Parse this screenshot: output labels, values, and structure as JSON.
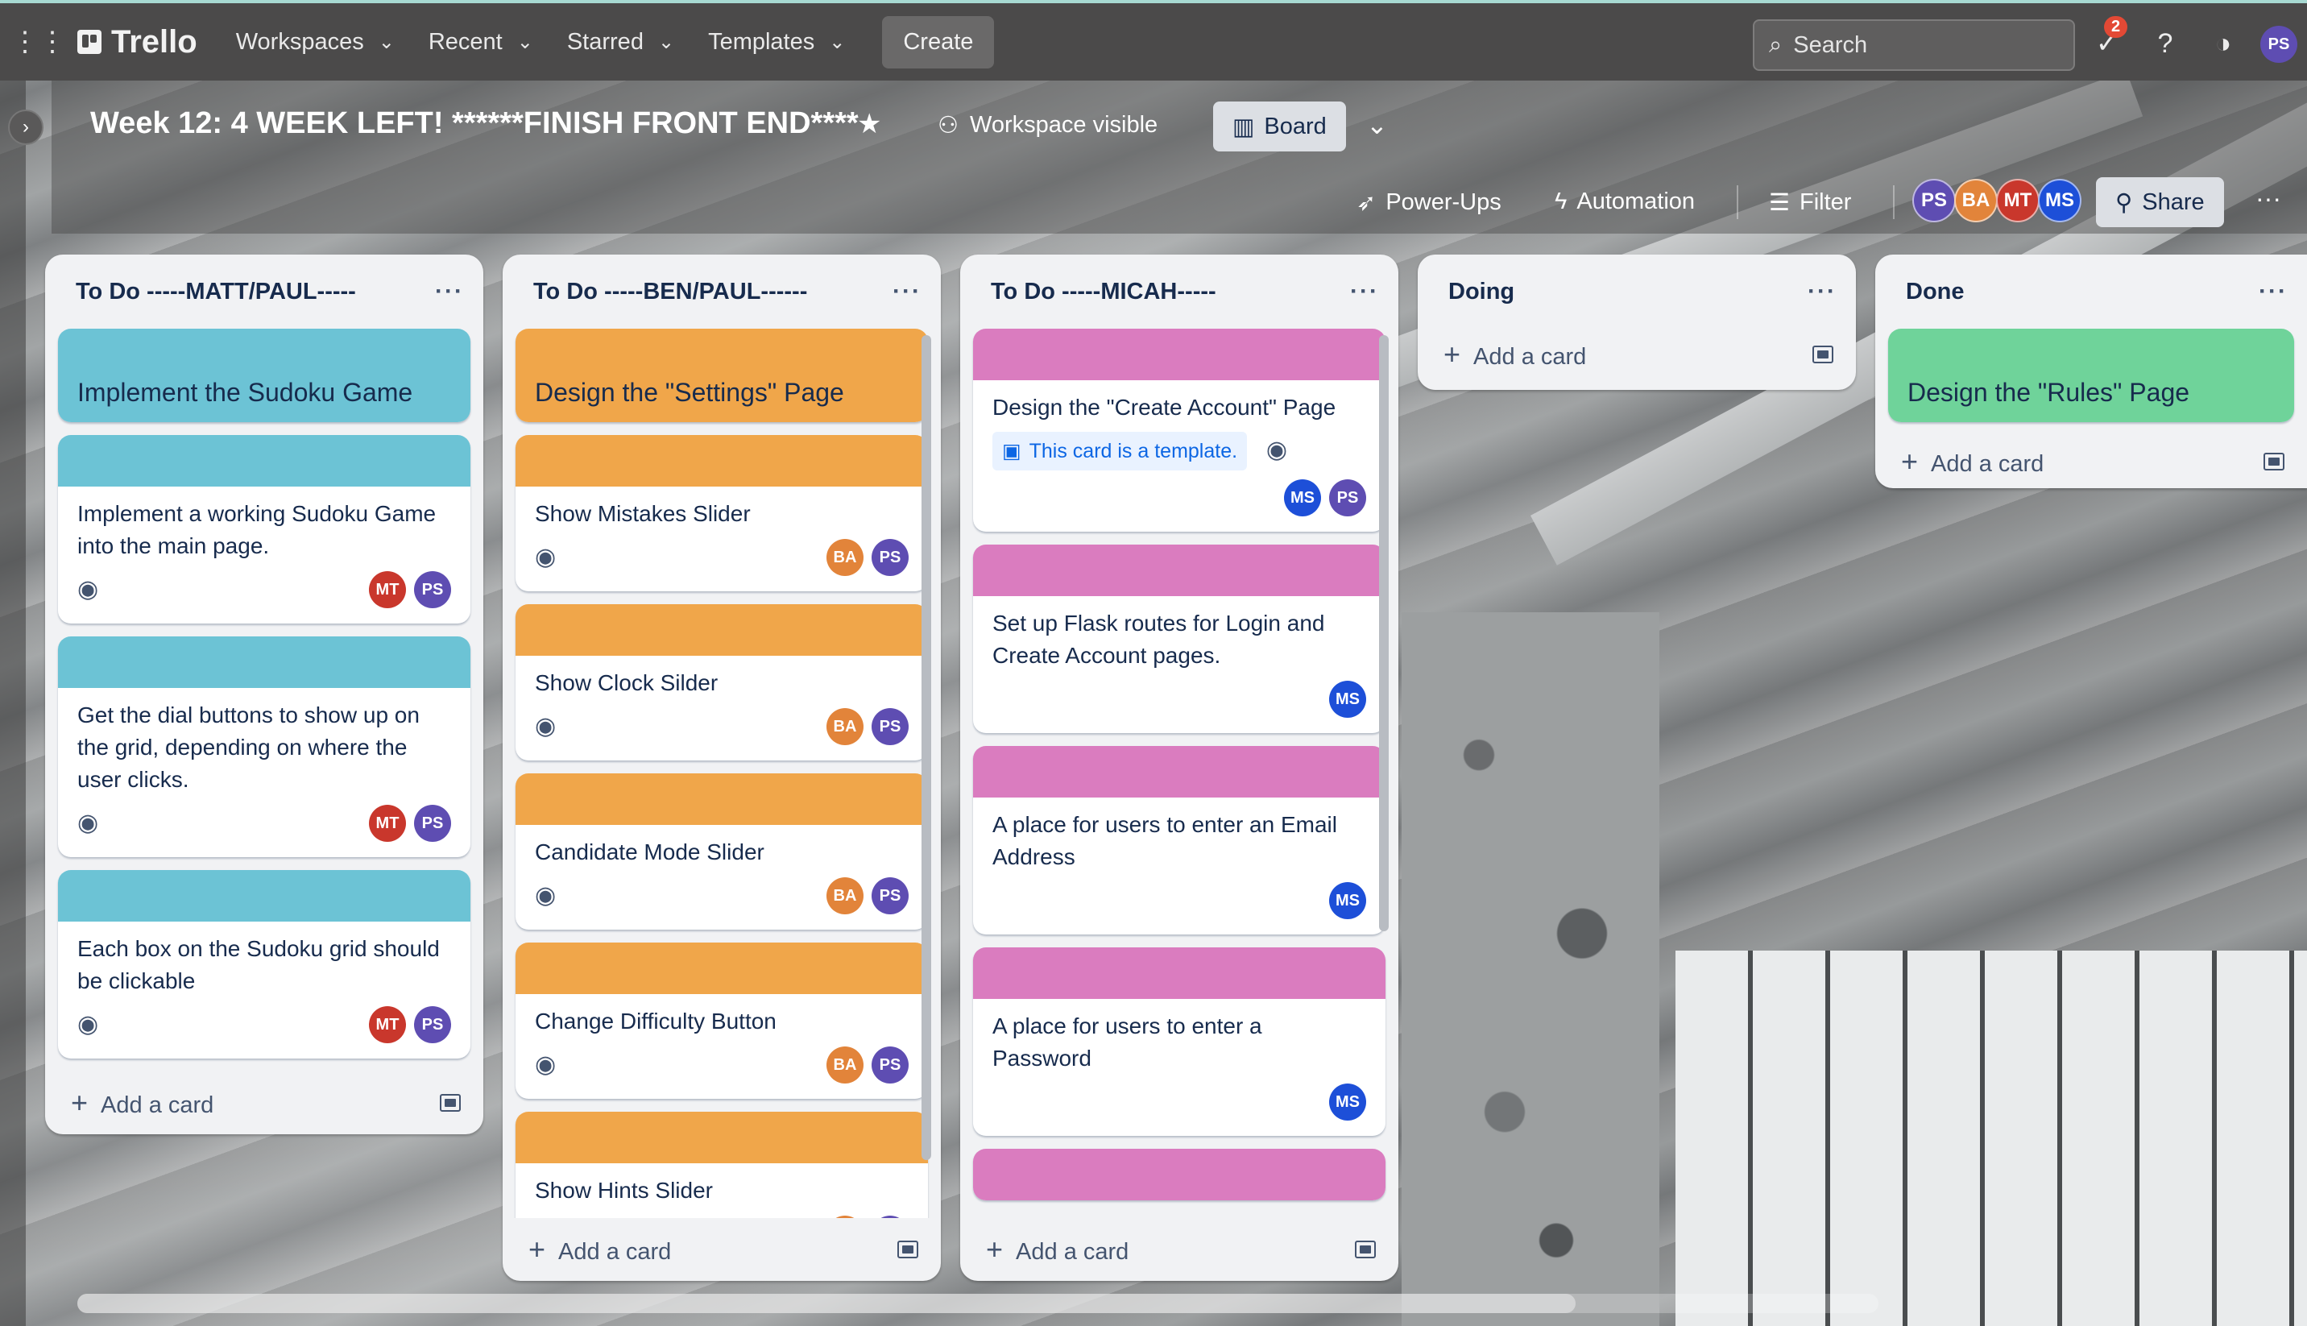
{
  "nav": {
    "logo": "Trello",
    "menus": [
      "Workspaces",
      "Recent",
      "Starred",
      "Templates"
    ],
    "create": "Create",
    "search_placeholder": "Search",
    "notifications_count": "2",
    "user_initials": "PS"
  },
  "board": {
    "title": "Week 12: 4 WEEK LEFT! ******FINISH FRONT END****",
    "visibility": "Workspace visible",
    "view": "Board",
    "power_ups": "Power-Ups",
    "automation": "Automation",
    "filter": "Filter",
    "members": [
      {
        "initials": "PS",
        "color": "#5e4db2"
      },
      {
        "initials": "BA",
        "color": "#e2843a"
      },
      {
        "initials": "MT",
        "color": "#c9372c"
      },
      {
        "initials": "MS",
        "color": "#1d4fd8"
      }
    ],
    "share": "Share"
  },
  "lists": [
    {
      "title": "To Do -----MATT/PAUL-----",
      "cover_color": "#6cc3d5",
      "cards": [
        {
          "cover_title": "Implement the Sudoku Game"
        },
        {
          "text": "Implement a working Sudoku Game into the main page.",
          "members": [
            "MT",
            "PS"
          ]
        },
        {
          "text": "Get the dial buttons to show up on the grid, depending on where the user clicks.",
          "members": [
            "MT",
            "PS"
          ]
        },
        {
          "text": "Each box on the Sudoku grid should be clickable",
          "members": [
            "MT",
            "PS"
          ]
        }
      ],
      "add_label": "Add a card"
    },
    {
      "title": "To Do -----BEN/PAUL------",
      "cover_color": "#f0a64a",
      "cards": [
        {
          "cover_title": "Design the \"Settings\" Page"
        },
        {
          "text": "Show Mistakes Slider",
          "members": [
            "BA",
            "PS"
          ]
        },
        {
          "text": "Show Clock Silder",
          "members": [
            "BA",
            "PS"
          ]
        },
        {
          "text": "Candidate Mode Slider",
          "members": [
            "BA",
            "PS"
          ]
        },
        {
          "text": "Change Difficulty Button",
          "members": [
            "BA",
            "PS"
          ]
        },
        {
          "text": "Show Hints Slider",
          "members": [
            "BA",
            "PS"
          ]
        }
      ],
      "add_label": "Add a card"
    },
    {
      "title": "To Do -----MICAH-----",
      "cover_color": "#da7cbf",
      "cards": [
        {
          "text": "Design the \"Create Account\" Page",
          "template_label": "This card is a template.",
          "members": [
            "MS",
            "PS"
          ]
        },
        {
          "text": "Set up Flask routes for Login and Create Account pages.",
          "members": [
            "MS"
          ]
        },
        {
          "text": "A place for users to enter an Email Address",
          "members": [
            "MS"
          ]
        },
        {
          "text": "A place for users to enter a Password",
          "members": [
            "MS"
          ]
        }
      ],
      "add_label": "Add a card"
    },
    {
      "title": "Doing",
      "add_label": "Add a card"
    },
    {
      "title": "Done",
      "cover_color": "#6fd39a",
      "cards": [
        {
          "cover_title": "Design the \"Rules\" Page"
        }
      ],
      "add_label": "Add a card"
    }
  ],
  "icons": {
    "apps": "grid-icon",
    "star": "star-icon",
    "eye": "eye-icon",
    "template": "template-icon"
  }
}
